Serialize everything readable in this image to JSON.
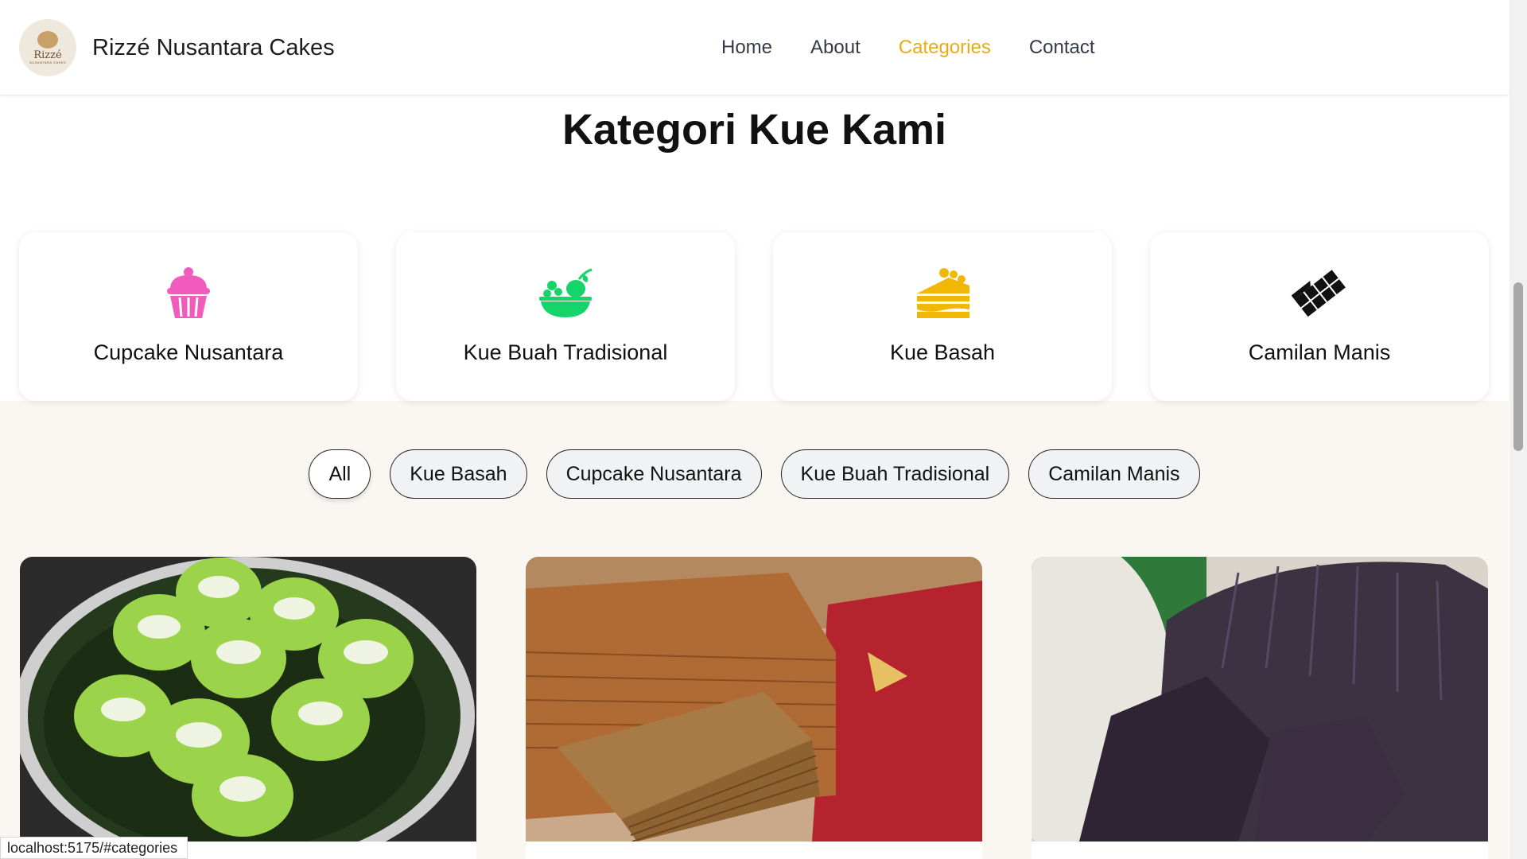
{
  "header": {
    "logo_text": "Rizzé",
    "logo_subtext": "NUSANTARA CAKES",
    "brand_name": "Rizzé Nusantara Cakes",
    "nav": [
      "Home",
      "About",
      "Categories",
      "Contact"
    ],
    "active_nav": "Categories"
  },
  "section_title": "Kategori Kue Kami",
  "categories": [
    {
      "label": "Cupcake Nusantara",
      "icon": "cupcake-icon",
      "color": "#f05bbd"
    },
    {
      "label": "Kue Buah Tradisional",
      "icon": "fruit-bowl-icon",
      "color": "#14d46a"
    },
    {
      "label": "Kue Basah",
      "icon": "cake-slice-icon",
      "color": "#f2b705"
    },
    {
      "label": "Camilan Manis",
      "icon": "chocolate-bar-icon",
      "color": "#111111"
    }
  ],
  "filters": [
    "All",
    "Kue Basah",
    "Cupcake Nusantara",
    "Kue Buah Tradisional",
    "Camilan Manis"
  ],
  "active_filter": "All",
  "status_url": "localhost:5175/#categories",
  "colors": {
    "accent": "#e8ab16",
    "section_bg": "#faf7f2"
  }
}
